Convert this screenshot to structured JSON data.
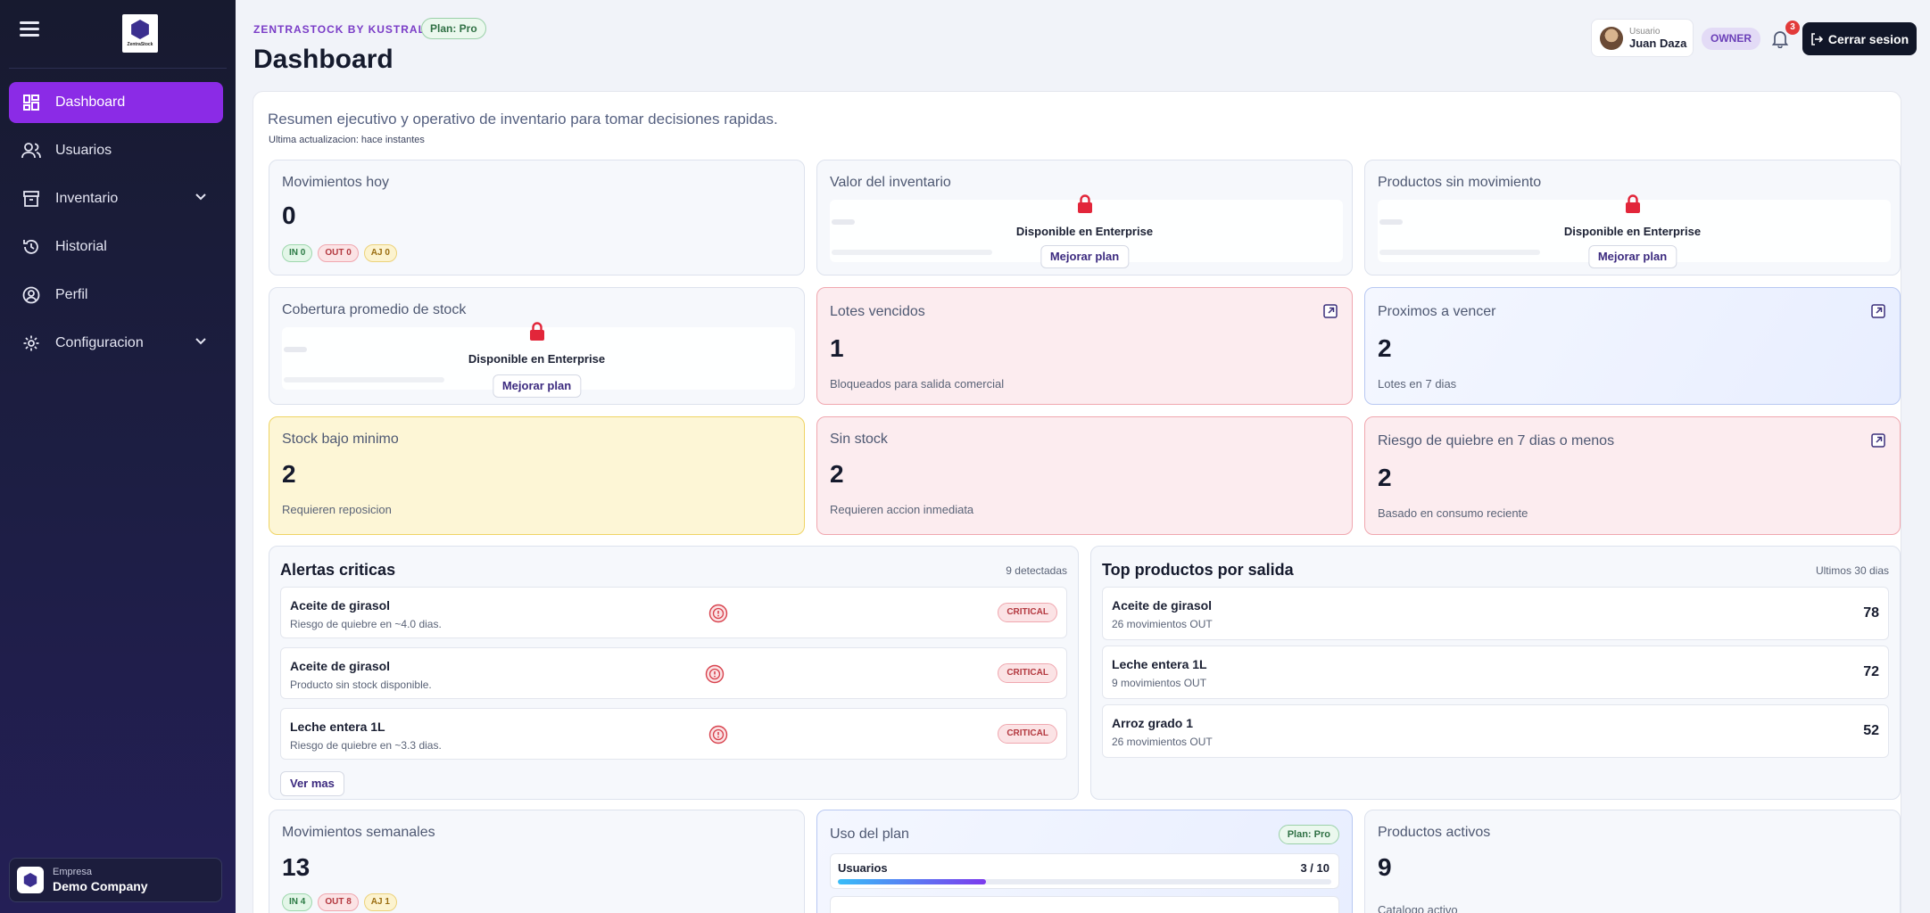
{
  "sidebar": {
    "logo_text": "ZentraStock",
    "items": [
      {
        "label": "Dashboard",
        "icon": "dashboard-icon",
        "active": true
      },
      {
        "label": "Usuarios",
        "icon": "users-icon"
      },
      {
        "label": "Inventario",
        "icon": "inventory-icon",
        "has_chevron": true
      },
      {
        "label": "Historial",
        "icon": "history-icon"
      },
      {
        "label": "Perfil",
        "icon": "profile-icon"
      },
      {
        "label": "Configuracion",
        "icon": "gear-icon",
        "has_chevron": true
      }
    ],
    "company": {
      "label": "Empresa",
      "name": "Demo Company"
    }
  },
  "header": {
    "brand": "ZENTRASTOCK BY KUSTRAL",
    "plan_badge": "Plan: Pro",
    "title": "Dashboard",
    "user_label": "Usuario",
    "user_name": "Juan Daza",
    "role": "OWNER",
    "notifications": "3",
    "logout": "Cerrar sesion"
  },
  "summary": {
    "intro": "Resumen ejecutivo y operativo de inventario para tomar decisiones rapidas.",
    "updated": "Ultima actualizacion: hace instantes"
  },
  "locked": {
    "text": "Disponible en Enterprise",
    "button": "Mejorar plan"
  },
  "cards": {
    "movimientos_hoy": {
      "title": "Movimientos hoy",
      "value": "0",
      "in": "IN 0",
      "out": "OUT 0",
      "aj": "AJ 0"
    },
    "valor_inventario": {
      "title": "Valor del inventario"
    },
    "sin_movimiento": {
      "title": "Productos sin movimiento"
    },
    "cobertura": {
      "title": "Cobertura promedio de stock"
    },
    "lotes_vencidos": {
      "title": "Lotes vencidos",
      "value": "1",
      "sub": "Bloqueados para salida comercial"
    },
    "proximos": {
      "title": "Proximos a vencer",
      "value": "2",
      "sub": "Lotes en 7 dias"
    },
    "stock_bajo": {
      "title": "Stock bajo minimo",
      "value": "2",
      "sub": "Requieren reposicion"
    },
    "sin_stock": {
      "title": "Sin stock",
      "value": "2",
      "sub": "Requieren accion inmediata"
    },
    "riesgo": {
      "title": "Riesgo de quiebre en 7 dias o menos",
      "value": "2",
      "sub": "Basado en consumo reciente"
    }
  },
  "alertas": {
    "title": "Alertas criticas",
    "count": "9 detectadas",
    "items": [
      {
        "name": "Aceite de girasol",
        "desc": "Riesgo de quiebre en ~4.0 dias.",
        "badge": "CRITICAL"
      },
      {
        "name": "Aceite de girasol",
        "desc": "Producto sin stock disponible.",
        "badge": "CRITICAL"
      },
      {
        "name": "Leche entera 1L",
        "desc": "Riesgo de quiebre en ~3.3 dias.",
        "badge": "CRITICAL"
      }
    ],
    "more": "Ver mas"
  },
  "top": {
    "title": "Top productos por salida",
    "period": "Ultimos 30 dias",
    "items": [
      {
        "name": "Aceite de girasol",
        "desc": "26 movimientos OUT",
        "value": "78"
      },
      {
        "name": "Leche entera 1L",
        "desc": "9 movimientos OUT",
        "value": "72"
      },
      {
        "name": "Arroz grado 1",
        "desc": "26 movimientos OUT",
        "value": "52"
      }
    ]
  },
  "semanales": {
    "title": "Movimientos semanales",
    "value": "13",
    "in": "IN 4",
    "out": "OUT 8",
    "aj": "AJ 1"
  },
  "uso_plan": {
    "title": "Uso del plan",
    "badge": "Plan: Pro",
    "users_label": "Usuarios",
    "users_value": "3 / 10",
    "users_fraction": 0.3
  },
  "activos": {
    "title": "Productos activos",
    "value": "9",
    "sub": "Catalogo activo"
  },
  "colors": {
    "accent": "#8b2be6",
    "danger": "#e23a3a"
  }
}
